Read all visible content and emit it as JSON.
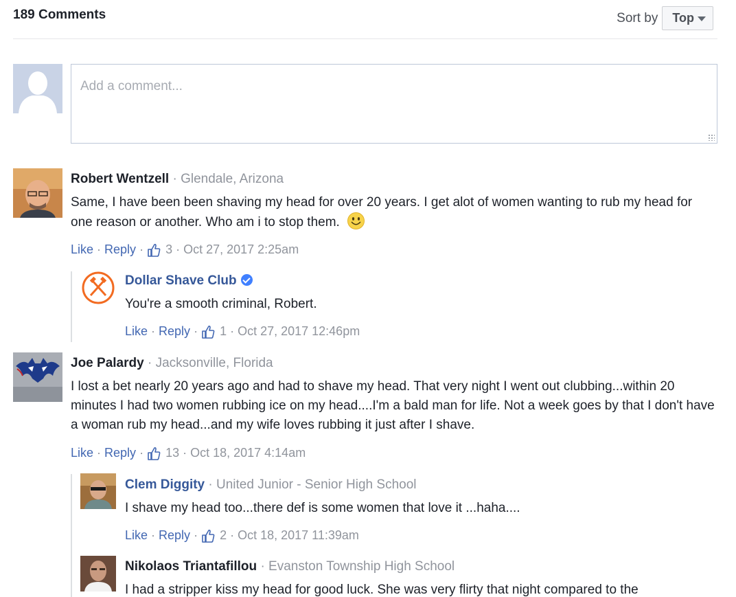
{
  "header": {
    "comment_count": "189 Comments",
    "sort_label": "Sort by",
    "sort_value": "Top"
  },
  "composer": {
    "placeholder": "Add a comment..."
  },
  "comments": [
    {
      "author": "Robert Wentzell",
      "location": "Glendale, Arizona",
      "text": "Same, I have been been shaving my head for over 20 years. I get alot of women wanting to rub my head for one reason or another. Who am i to stop them.",
      "like": "Like",
      "reply": "Reply",
      "likes": "3",
      "time": "Oct 27, 2017 2:25am",
      "replies": [
        {
          "author": "Dollar Shave Club",
          "verified": true,
          "text": "You're a smooth criminal, Robert.",
          "like": "Like",
          "reply": "Reply",
          "likes": "1",
          "time": "Oct 27, 2017 12:46pm"
        }
      ]
    },
    {
      "author": "Joe Palardy",
      "location": "Jacksonville, Florida",
      "text": "I lost a bet nearly 20 years ago and had to shave my head. That very night I went out clubbing...within 20 minutes I had two women rubbing ice on my head....I'm a bald man for life. Not a week goes by that I don't have a woman rub my head...and my wife loves rubbing it just after I shave.",
      "like": "Like",
      "reply": "Reply",
      "likes": "13",
      "time": "Oct 18, 2017 4:14am",
      "replies": [
        {
          "author": "Clem Diggity",
          "location": "United Junior - Senior High School",
          "text": "I shave my head too...there def is some women that love it ...haha....",
          "like": "Like",
          "reply": "Reply",
          "likes": "2",
          "time": "Oct 18, 2017 11:39am"
        },
        {
          "author": "Nikolaos Triantafillou",
          "location": "Evanston Township High School",
          "text": "I had a stripper kiss my head for good luck. She was very flirty that night compared to the"
        }
      ]
    }
  ],
  "icons": {
    "thumb": "thumbs-up-icon",
    "smile": "smile-emoji-icon",
    "verified": "verified-badge-icon",
    "sort_caret": "caret-down-icon"
  },
  "colors": {
    "link": "#4267b2",
    "name_link": "#365899",
    "muted": "#90949c",
    "text": "#1d2129",
    "dsc_orange": "#f26b21"
  }
}
